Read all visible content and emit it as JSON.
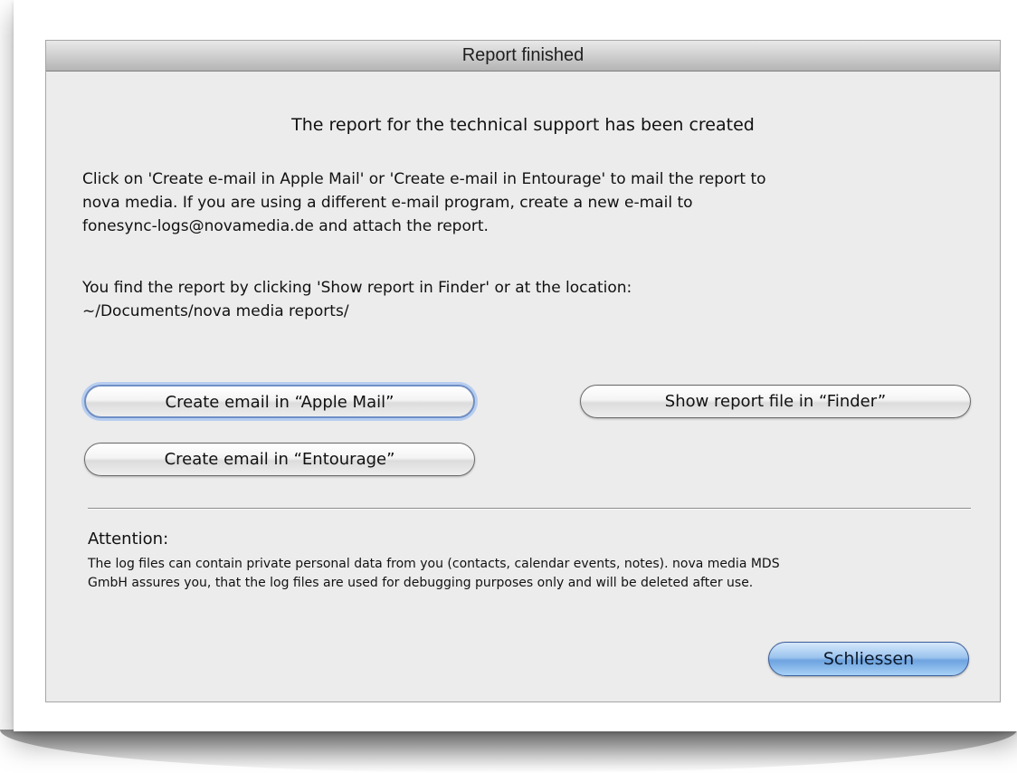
{
  "window": {
    "title": "Report finished"
  },
  "content": {
    "heading": "The report for the technical support has been created",
    "paragraph1": "Click on 'Create e-mail in Apple Mail' or 'Create e-mail in Entourage' to mail the report to\nnova media. If you are using a different e-mail program, create a new e-mail to\nfonesync-logs@novamedia.de and attach the report.",
    "paragraph2": "You find the report by clicking 'Show report in Finder' or at the location:\n~/Documents/nova media reports/"
  },
  "buttons": {
    "apple_mail": "Create email in “Apple Mail”",
    "entourage": "Create email in “Entourage”",
    "finder": "Show report file in “Finder”",
    "close": "Schliessen"
  },
  "attention": {
    "title": "Attention:",
    "body": "The log files can contain private personal data from you (contacts, calendar events, notes). nova media MDS\nGmbH assures you, that the log files are used for debugging purposes only and will be deleted after use."
  },
  "colors": {
    "dialog_background": "#ececec",
    "default_button_accent": "#6da3e0"
  }
}
